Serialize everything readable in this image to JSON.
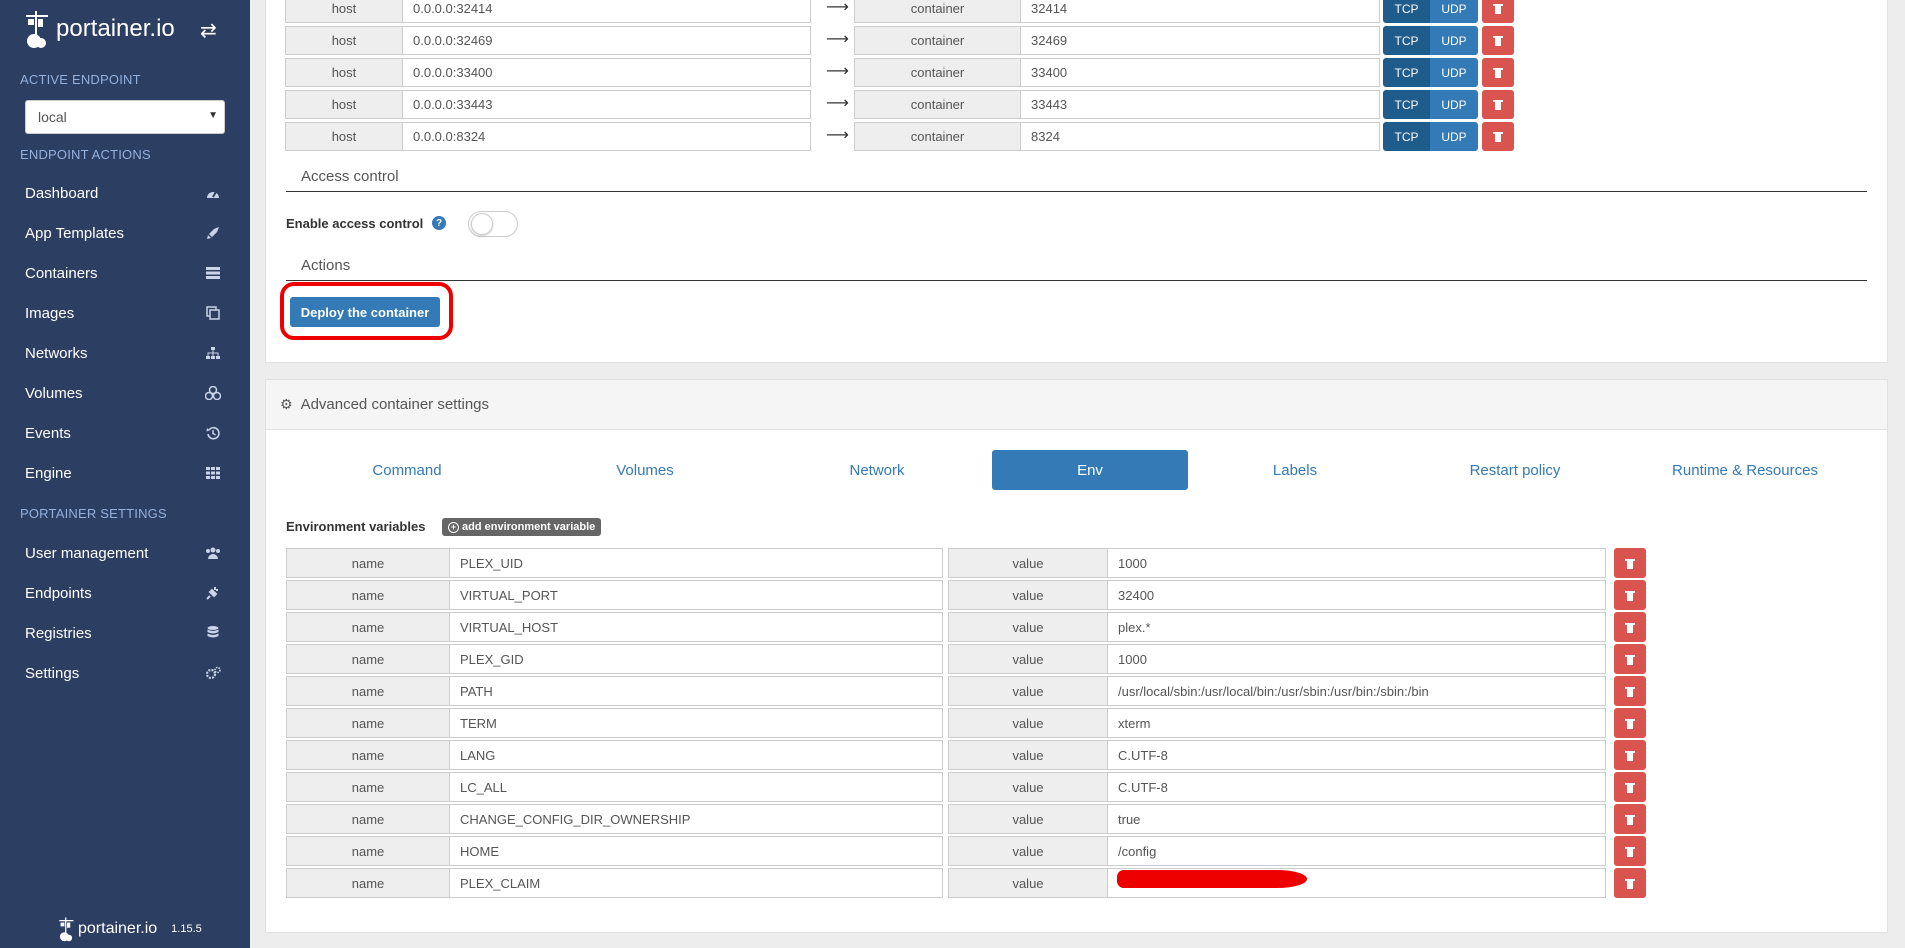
{
  "app": {
    "brand": "portainer.io",
    "version": "1.15.5"
  },
  "sidebar": {
    "active_endpoint_title": "ACTIVE ENDPOINT",
    "endpoint_value": "local",
    "endpoint_actions_title": "ENDPOINT ACTIONS",
    "endpoint_items": [
      {
        "label": "Dashboard",
        "icon": "dashboard-icon"
      },
      {
        "label": "App Templates",
        "icon": "rocket-icon"
      },
      {
        "label": "Containers",
        "icon": "server-icon"
      },
      {
        "label": "Images",
        "icon": "clone-icon"
      },
      {
        "label": "Networks",
        "icon": "sitemap-icon"
      },
      {
        "label": "Volumes",
        "icon": "cubes-icon"
      },
      {
        "label": "Events",
        "icon": "history-icon"
      },
      {
        "label": "Engine",
        "icon": "th-icon"
      }
    ],
    "portainer_settings_title": "PORTAINER SETTINGS",
    "settings_items": [
      {
        "label": "User management",
        "icon": "users-icon"
      },
      {
        "label": "Endpoints",
        "icon": "plug-icon"
      },
      {
        "label": "Registries",
        "icon": "database-icon"
      },
      {
        "label": "Settings",
        "icon": "cogs-icon"
      }
    ]
  },
  "ports": {
    "host_label": "host",
    "container_label": "container",
    "tcp_label": "TCP",
    "udp_label": "UDP",
    "rows": [
      {
        "host": "0.0.0.0:32414",
        "container": "32414"
      },
      {
        "host": "0.0.0.0:32469",
        "container": "32469"
      },
      {
        "host": "0.0.0.0:33400",
        "container": "33400"
      },
      {
        "host": "0.0.0.0:33443",
        "container": "33443"
      },
      {
        "host": "0.0.0.0:8324",
        "container": "8324"
      }
    ]
  },
  "access_control": {
    "title": "Access control",
    "enable_label": "Enable access control",
    "enabled": false
  },
  "actions": {
    "title": "Actions",
    "deploy_label": "Deploy the container"
  },
  "advanced": {
    "title": "Advanced container settings",
    "tabs": [
      "Command",
      "Volumes",
      "Network",
      "Env",
      "Labels",
      "Restart policy",
      "Runtime & Resources"
    ],
    "active_tab": "Env"
  },
  "env": {
    "title": "Environment variables",
    "add_label": "add environment variable",
    "name_label": "name",
    "value_label": "value",
    "rows": [
      {
        "name": "PLEX_UID",
        "value": "1000"
      },
      {
        "name": "VIRTUAL_PORT",
        "value": "32400"
      },
      {
        "name": "VIRTUAL_HOST",
        "value": "plex.*"
      },
      {
        "name": "PLEX_GID",
        "value": "1000"
      },
      {
        "name": "PATH",
        "value": "/usr/local/sbin:/usr/local/bin:/usr/sbin:/usr/bin:/sbin:/bin"
      },
      {
        "name": "TERM",
        "value": "xterm"
      },
      {
        "name": "LANG",
        "value": "C.UTF-8"
      },
      {
        "name": "LC_ALL",
        "value": "C.UTF-8"
      },
      {
        "name": "CHANGE_CONFIG_DIR_OWNERSHIP",
        "value": "true"
      },
      {
        "name": "HOME",
        "value": "/config"
      },
      {
        "name": "PLEX_CLAIM",
        "value": ""
      }
    ]
  },
  "colors": {
    "sidebar": "#2d3e63",
    "primary": "#337ab7",
    "tcp_active": "#1e5c8c",
    "danger": "#d9534f",
    "annotation": "#ee0000"
  }
}
